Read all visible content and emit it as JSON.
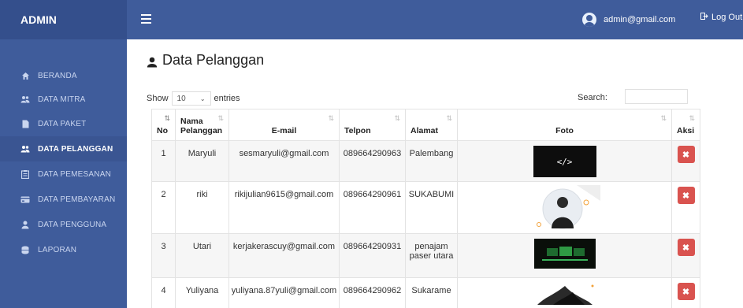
{
  "brand": "ADMIN",
  "sidebar": {
    "items": [
      {
        "label": "BERANDA",
        "icon": "home-icon"
      },
      {
        "label": "DATA MITRA",
        "icon": "users-icon"
      },
      {
        "label": "DATA PAKET",
        "icon": "file-icon"
      },
      {
        "label": "DATA PELANGGAN",
        "icon": "users-icon"
      },
      {
        "label": "DATA PEMESANAN",
        "icon": "clipboard-icon"
      },
      {
        "label": "DATA PEMBAYARAN",
        "icon": "credit-card-icon"
      },
      {
        "label": "DATA PENGGUNA",
        "icon": "user-icon"
      },
      {
        "label": "LAPORAN",
        "icon": "database-icon"
      }
    ],
    "active_index": 3
  },
  "topbar": {
    "user_email": "admin@gmail.com",
    "logout_label": "Log Out"
  },
  "page": {
    "title": "Data Pelanggan"
  },
  "table_controls": {
    "show_label": "Show",
    "entries_value": "10",
    "entries_label": "entries",
    "search_label": "Search:"
  },
  "table": {
    "headers": [
      "No",
      "Nama Pelanggan",
      "E-mail",
      "Telpon",
      "Alamat",
      "Foto",
      "Aksi"
    ],
    "header_name_line1": "Nama",
    "header_name_line2": "Pelanggan",
    "rows": [
      {
        "no": "1",
        "nama": "Maryuli",
        "email": "sesmaryuli@gmail.com",
        "telpon": "089664290963",
        "alamat": "Palembang",
        "foto": "code-icon-photo"
      },
      {
        "no": "2",
        "nama": "riki",
        "email": "rikijulian9615@gmail.com",
        "telpon": "089664290961",
        "alamat": "SUKABUMI",
        "foto": "portrait-photo"
      },
      {
        "no": "3",
        "nama": "Utari",
        "email": "kerjakerascuy@gmail.com",
        "telpon": "089664290931",
        "alamat": "penajam paser utara",
        "foto": "screen-photo"
      },
      {
        "no": "4",
        "nama": "Yuliyana",
        "email": "yuliyana.87yuli@gmail.com",
        "telpon": "089664290962",
        "alamat": "Sukarame",
        "foto": "dark-art-photo"
      }
    ],
    "code_glyph": "</>"
  },
  "colors": {
    "sidebar": "#3f5c9b",
    "delete_button": "#d9534f"
  }
}
